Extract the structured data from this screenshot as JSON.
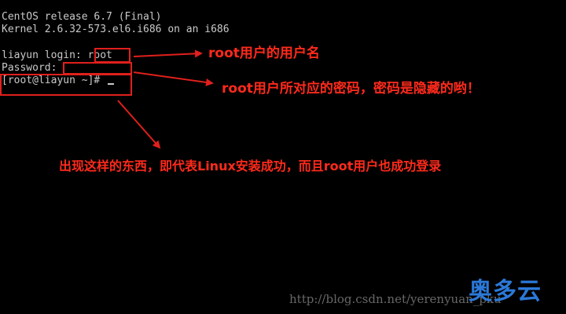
{
  "terminal": {
    "line1": "CentOS release 6.7 (Final)",
    "line2": "Kernel 2.6.32-573.el6.i686 on an i686",
    "login_prefix": "liayun login: ",
    "login_value": "root",
    "password_prompt": "Password:",
    "shell_prompt": "[root@liayun ~]# "
  },
  "annotations": {
    "username_note": "root用户的用户名",
    "password_note": "root用户所对应的密码，密码是隐藏的哟！",
    "success_note": "出现这样的东西，即代表Linux安装成功，而且root用户也成功登录"
  },
  "watermark": {
    "url": "http://blog.csdn.net/yerenyuan_pku",
    "logo": "奥多云"
  },
  "colors": {
    "background": "#000000",
    "terminal_text": "#c9c9c9",
    "annotation_red": "#ff2a1c",
    "logo_blue": "#2b79d8"
  }
}
